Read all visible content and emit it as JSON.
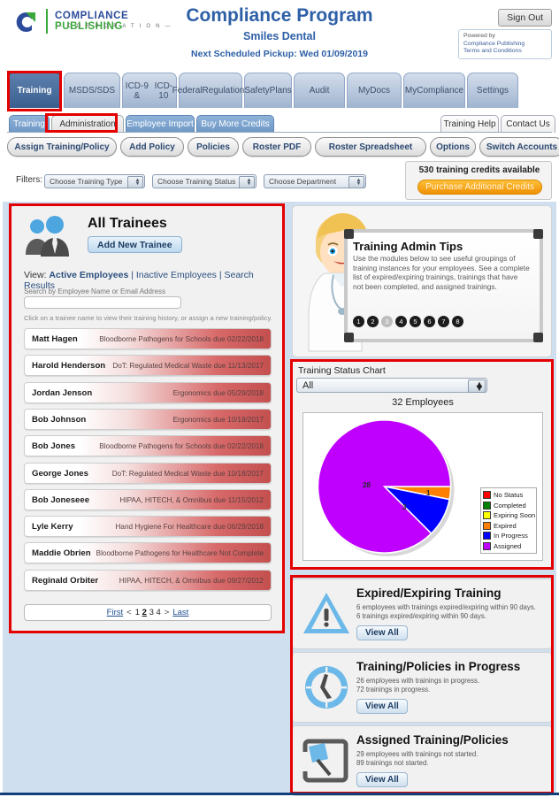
{
  "header": {
    "logo_line1_blue": "COMPLIANCE",
    "logo_line1_green": "PUBLISHING",
    "logo_line2": "— C O R P O R A T I O N —",
    "app_title": "Compliance Program",
    "company": "Smiles Dental",
    "pickup": "Next Scheduled Pickup: Wed 01/09/2019",
    "sign_out": "Sign Out",
    "powered_by": "Powered by",
    "powered_name": "Compliance Publishing",
    "terms": "Terms and Conditions"
  },
  "main_tabs": [
    {
      "label": "Training",
      "active": true,
      "highlight": true
    },
    {
      "label": "MSDS/SDS",
      "active": false
    },
    {
      "label": "ICD-9 &\nICD-10",
      "active": false
    },
    {
      "label": "Federal\nRegulations",
      "active": false
    },
    {
      "label": "Safety\nPlans",
      "active": false
    },
    {
      "label": "Audit",
      "active": false
    },
    {
      "label": "MyDocs",
      "active": false
    },
    {
      "label": "My\nCompliance",
      "active": false
    },
    {
      "label": "Settings",
      "active": false
    }
  ],
  "sub_tabs": [
    {
      "label": "Training",
      "selected": false
    },
    {
      "label": "Administration",
      "selected": true,
      "highlight": true
    },
    {
      "label": "Employee Import",
      "selected": false
    },
    {
      "label": "Buy More Credits",
      "selected": false
    }
  ],
  "help_tabs": [
    {
      "label": "Training Help"
    },
    {
      "label": "Contact Us"
    }
  ],
  "action_buttons": [
    {
      "label": "Assign Training/Policy"
    },
    {
      "label": "Add Policy"
    },
    {
      "label": "Policies"
    },
    {
      "label": "Roster PDF"
    },
    {
      "label": "Roster Spreadsheet"
    },
    {
      "label": "Options"
    },
    {
      "label": "Switch Accounts"
    }
  ],
  "filters": {
    "label": "Filters:",
    "selects": [
      {
        "value": "Choose Training Type"
      },
      {
        "value": "Choose Training Status"
      },
      {
        "value": "Choose Department"
      }
    ]
  },
  "credits": {
    "text": "530 training credits available",
    "button": "Purchase Additional Credits"
  },
  "trainees": {
    "title": "All Trainees",
    "add_button": "Add New Trainee",
    "view_label": "View:",
    "view_active": "Active Employees",
    "view_inactive": "Inactive Employees",
    "view_search": "Search Results",
    "search_label": "Search by Employee Name or Email Address",
    "search_value": "",
    "hint": "Click on a trainee name to view their training history, or assign a new training/policy.",
    "rows": [
      {
        "name": "Matt Hagen",
        "detail": "Bloodborne Pathogens for Schools due 02/22/2018"
      },
      {
        "name": "Harold Henderson",
        "detail": "DoT: Regulated Medical Waste due 11/13/2017"
      },
      {
        "name": "Jordan Jenson",
        "detail": "Ergonomics due 05/29/2018"
      },
      {
        "name": "Bob Johnson",
        "detail": "Ergonomics due 10/18/2017"
      },
      {
        "name": "Bob Jones",
        "detail": "Bloodborne Pathogens for Schools due 02/22/2018"
      },
      {
        "name": "George Jones",
        "detail": "DoT: Regulated Medical Waste due 10/18/2017"
      },
      {
        "name": "Bob Joneseee",
        "detail": "HIPAA, HITECH, & Omnibus due 11/15/2012"
      },
      {
        "name": "Lyle Kerry",
        "detail": "Hand Hygiene For Healthcare due 06/29/2018"
      },
      {
        "name": "Maddie Obrien",
        "detail": "Bloodborne Pathogens for Healthcare Not Complete"
      },
      {
        "name": "Reginald Orbiter",
        "detail": "HIPAA, HITECH, & Omnibus due 09/27/2012"
      }
    ],
    "pager": {
      "first": "First",
      "prev": "<",
      "pages": [
        "1",
        "2",
        "3",
        "4"
      ],
      "current": "2",
      "next": ">",
      "last": "Last"
    }
  },
  "tips": {
    "title": "Training Admin Tips",
    "body": "Use the modules below to see useful groupings of training instances for your employees. See a complete list of expired/expiring trainings, trainings that have not been completed, and assigned trainings.",
    "dots": [
      "1",
      "2",
      "3",
      "4",
      "5",
      "6",
      "7",
      "8"
    ],
    "active_dot": "3"
  },
  "chart_panel": {
    "label": "Training Status Chart",
    "selected": "All",
    "employees": "32 Employees"
  },
  "chart_data": {
    "type": "pie",
    "title": "32 Employees",
    "categories": [
      "No Status",
      "Completed",
      "Expiring Soon",
      "Expired",
      "In Progress",
      "Assigned"
    ],
    "values": [
      0,
      0,
      0,
      1,
      3,
      28
    ],
    "colors": [
      "#ff0000",
      "#008000",
      "#ffff00",
      "#ff8000",
      "#0000ff",
      "#bf00ff"
    ],
    "labels_shown": {
      "Expired": "1",
      "In Progress": "3",
      "Assigned": "28"
    },
    "legend_position": "right",
    "total": 32
  },
  "modules": [
    {
      "title": "Expired/Expiring Training",
      "line1": "6 employees with trainings expired/expiring within 90 days.",
      "line2": "6 trainings expired/expiring within 90 days.",
      "button": "View All",
      "icon": "warning-triangle-icon"
    },
    {
      "title": "Training/Policies in Progress",
      "line1": "26 employees with trainings in progress.",
      "line2": "72 trainings in progress.",
      "button": "View All",
      "icon": "clock-icon"
    },
    {
      "title": "Assigned Training/Policies",
      "line1": "29 employees with trainings not started.",
      "line2": "89 trainings not started.",
      "button": "View All",
      "icon": "pin-board-icon"
    }
  ]
}
